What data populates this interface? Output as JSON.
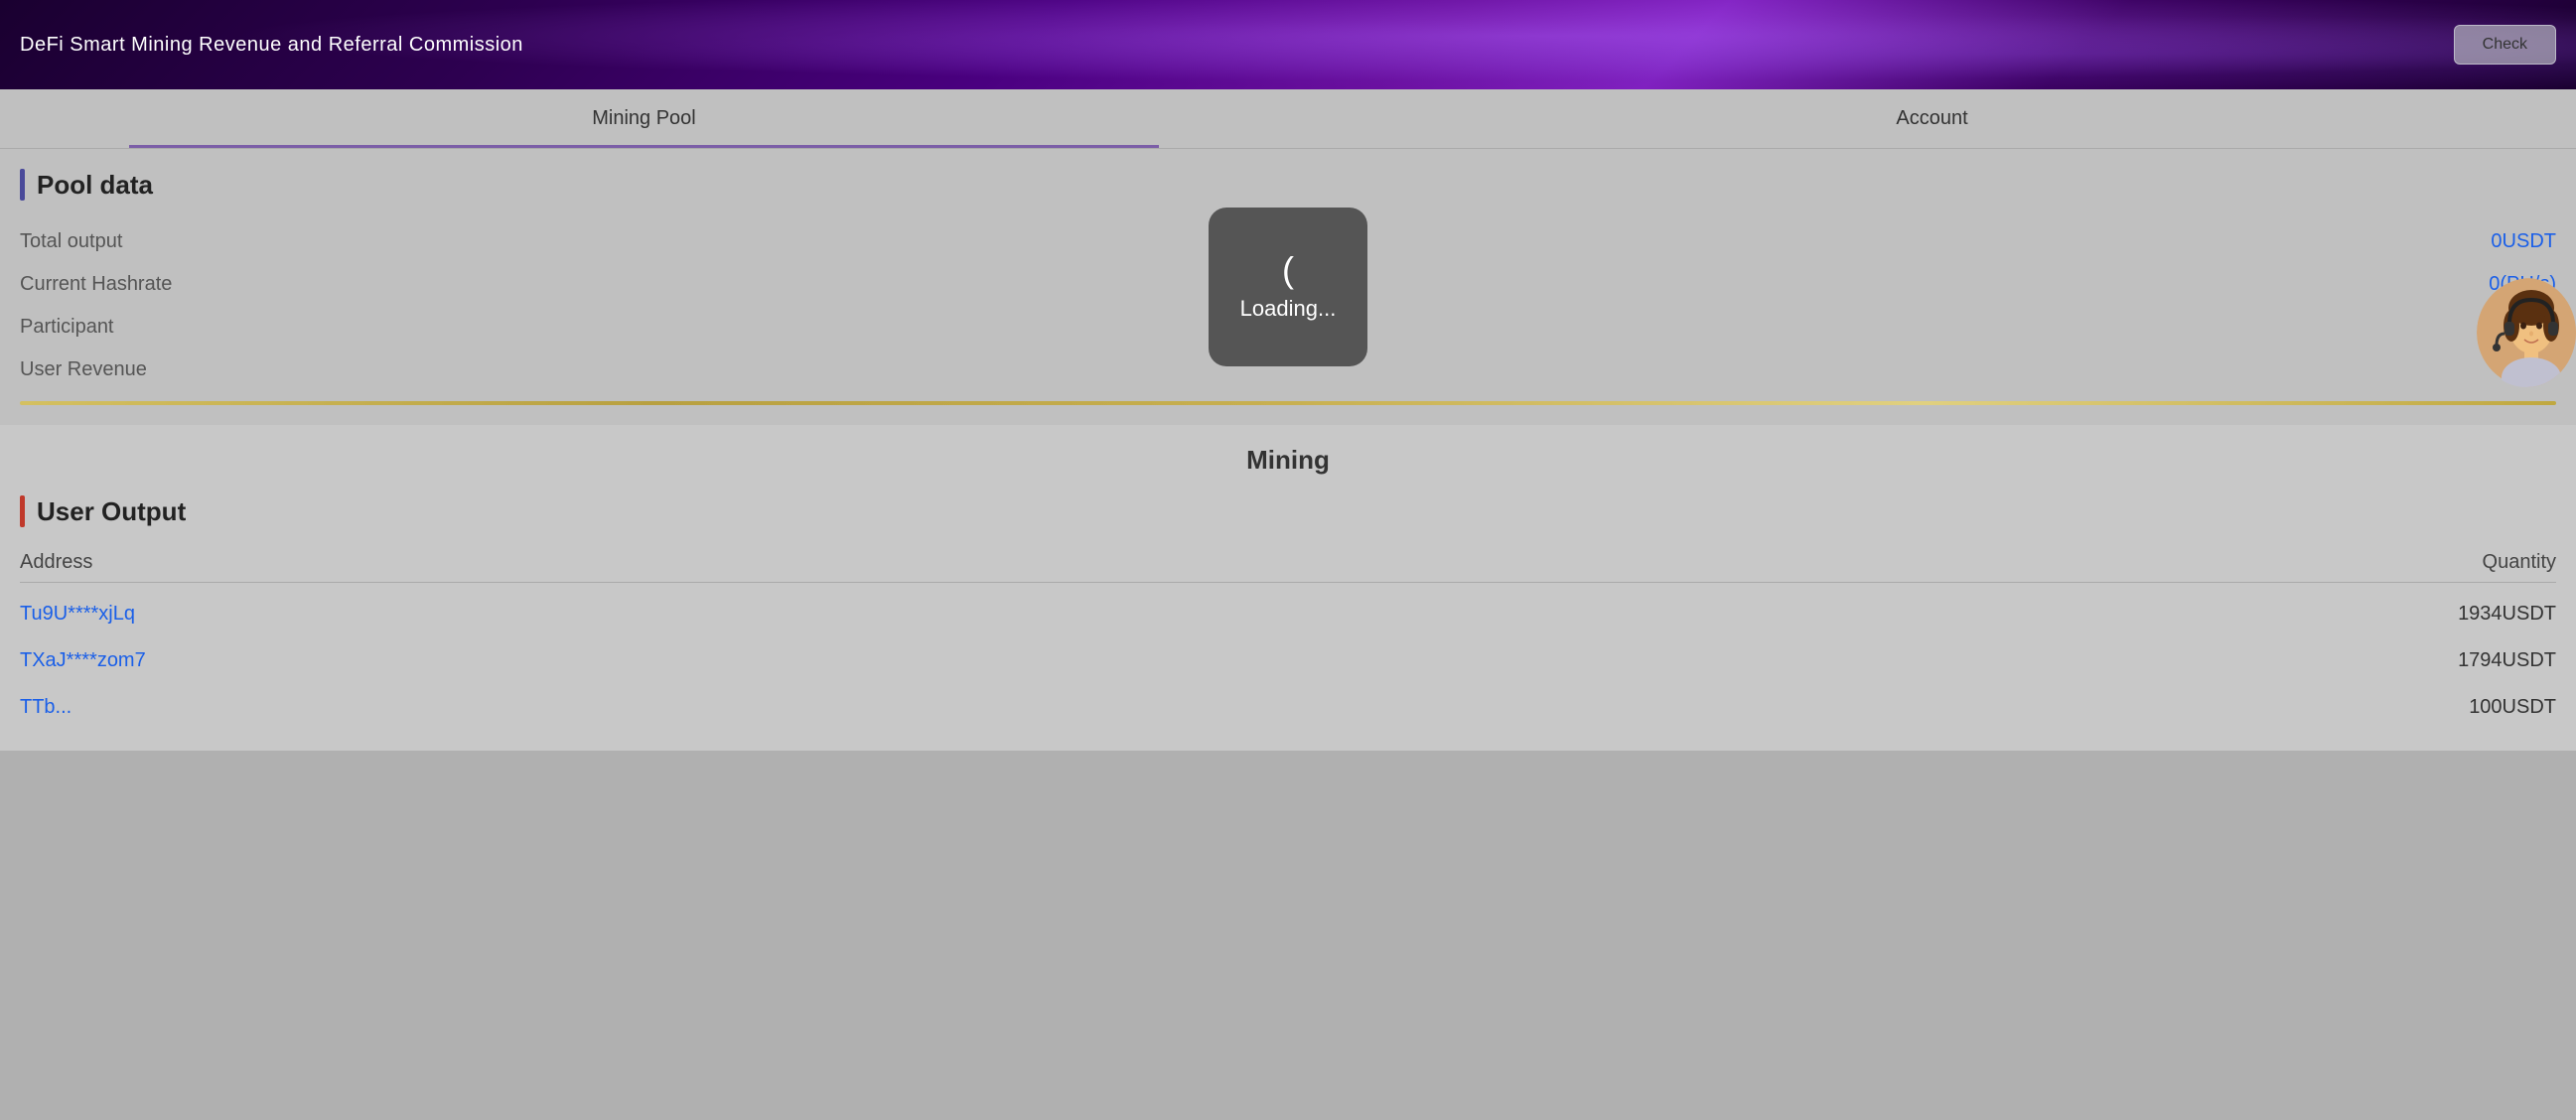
{
  "header": {
    "title": "DeFi Smart Mining Revenue and Referral Commission",
    "check_button": "Check"
  },
  "tabs": [
    {
      "id": "mining-pool",
      "label": "Mining Pool",
      "active": true
    },
    {
      "id": "account",
      "label": "Account",
      "active": false
    }
  ],
  "pool_data": {
    "heading": "Pool data",
    "rows": [
      {
        "label": "Total output",
        "value": "0USDT"
      },
      {
        "label": "Current Hashrate",
        "value": "0(PH/s)"
      },
      {
        "label": "Participant",
        "value": ""
      },
      {
        "label": "User Revenue",
        "value": ""
      }
    ]
  },
  "mining": {
    "title": "Mining"
  },
  "user_output": {
    "heading": "User Output",
    "columns": {
      "address": "Address",
      "quantity": "Quantity"
    },
    "rows": [
      {
        "address": "Tu9U****xjLq",
        "quantity": "1934USDT"
      },
      {
        "address": "TXaJ****zom7",
        "quantity": "1794USDT"
      },
      {
        "address": "TTb...",
        "quantity": "100USDT"
      }
    ]
  },
  "loading": {
    "paren": "(",
    "text": "Loading..."
  }
}
